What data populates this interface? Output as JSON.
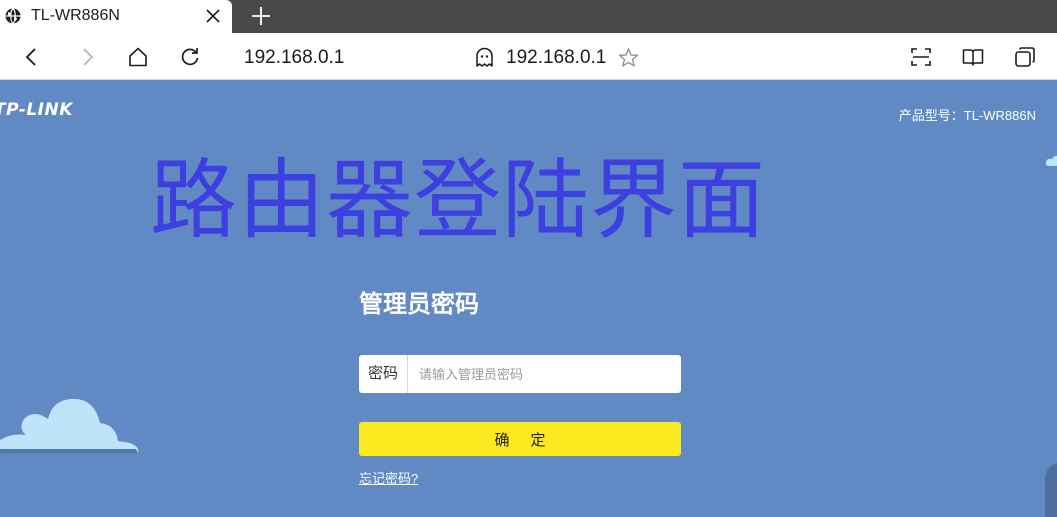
{
  "browser": {
    "tab": {
      "title": "TL-WR886N",
      "globe_icon": "globe-icon",
      "close_icon": "close-icon"
    },
    "new_tab_icon": "plus-icon",
    "toolbar": {
      "back_icon": "chevron-left-icon",
      "forward_icon": "chevron-right-icon",
      "home_icon": "home-icon",
      "reload_icon": "reload-icon",
      "address_text": "192.168.0.1",
      "center_url": "192.168.0.1",
      "ghost_icon": "incognito-ghost-icon",
      "star_icon": "star-icon",
      "scan_icon": "scan-icon",
      "reader_icon": "book-icon",
      "tabs_icon": "tabs-icon"
    }
  },
  "page": {
    "logo": "TP-LINK",
    "model": "产品型号：TL-WR886N",
    "watermark": "路由器登陆界面",
    "heading": "管理员密码",
    "password_label": "密码",
    "password_placeholder": "请输入管理员密码",
    "password_value": "",
    "confirm_label": "确定",
    "forgot_link": "忘记密码?"
  },
  "colors": {
    "page_background": "#6189c4",
    "watermark": "#3d3fe0",
    "confirm_button": "#fde91f",
    "cloud": "#bfe3f8",
    "tab_strip": "#4a4a4c"
  }
}
